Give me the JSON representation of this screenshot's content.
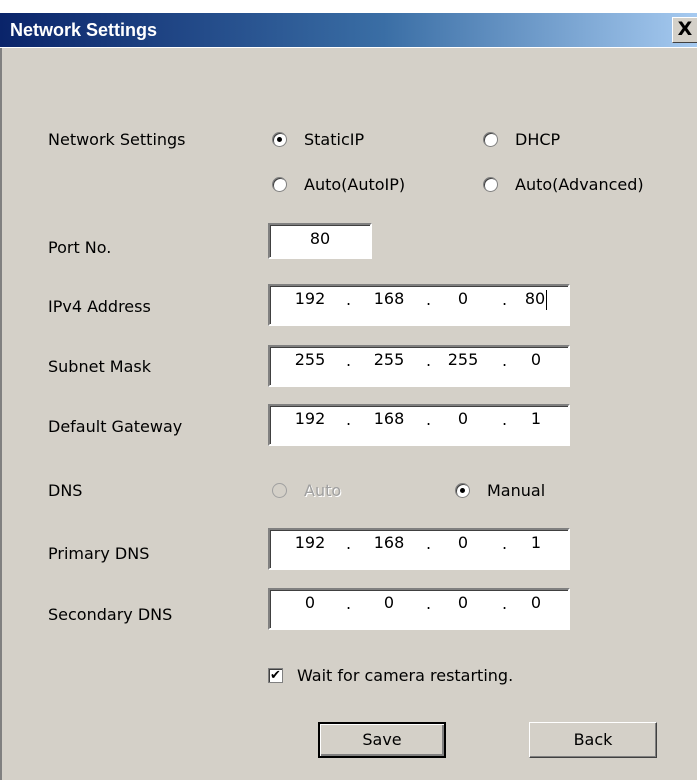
{
  "window": {
    "title": "Network Settings",
    "close_label": "X"
  },
  "network_settings": {
    "label": "Network Settings",
    "options": [
      {
        "label": "StaticIP",
        "checked": true,
        "disabled": false
      },
      {
        "label": "DHCP",
        "checked": false,
        "disabled": false
      },
      {
        "label": "Auto(AutoIP)",
        "checked": false,
        "disabled": false
      },
      {
        "label": "Auto(Advanced)",
        "checked": false,
        "disabled": false
      }
    ]
  },
  "port": {
    "label": "Port No.",
    "value": "80"
  },
  "ipv4": {
    "label": "IPv4 Address",
    "octets": [
      "192",
      "168",
      "0",
      "80"
    ]
  },
  "subnet": {
    "label": "Subnet Mask",
    "octets": [
      "255",
      "255",
      "255",
      "0"
    ]
  },
  "gateway": {
    "label": "Default Gateway",
    "octets": [
      "192",
      "168",
      "0",
      "1"
    ]
  },
  "dns": {
    "label": "DNS",
    "options": [
      {
        "label": "Auto",
        "checked": false,
        "disabled": true
      },
      {
        "label": "Manual",
        "checked": true,
        "disabled": false
      }
    ]
  },
  "primary_dns": {
    "label": "Primary DNS",
    "octets": [
      "192",
      "168",
      "0",
      "1"
    ]
  },
  "secondary_dns": {
    "label": "Secondary DNS",
    "octets": [
      "0",
      "0",
      "0",
      "0"
    ]
  },
  "wait_restart": {
    "label": "Wait for camera restarting.",
    "checked": true,
    "check_glyph": "✔"
  },
  "buttons": {
    "save": "Save",
    "back": "Back"
  },
  "ip_separator": "."
}
